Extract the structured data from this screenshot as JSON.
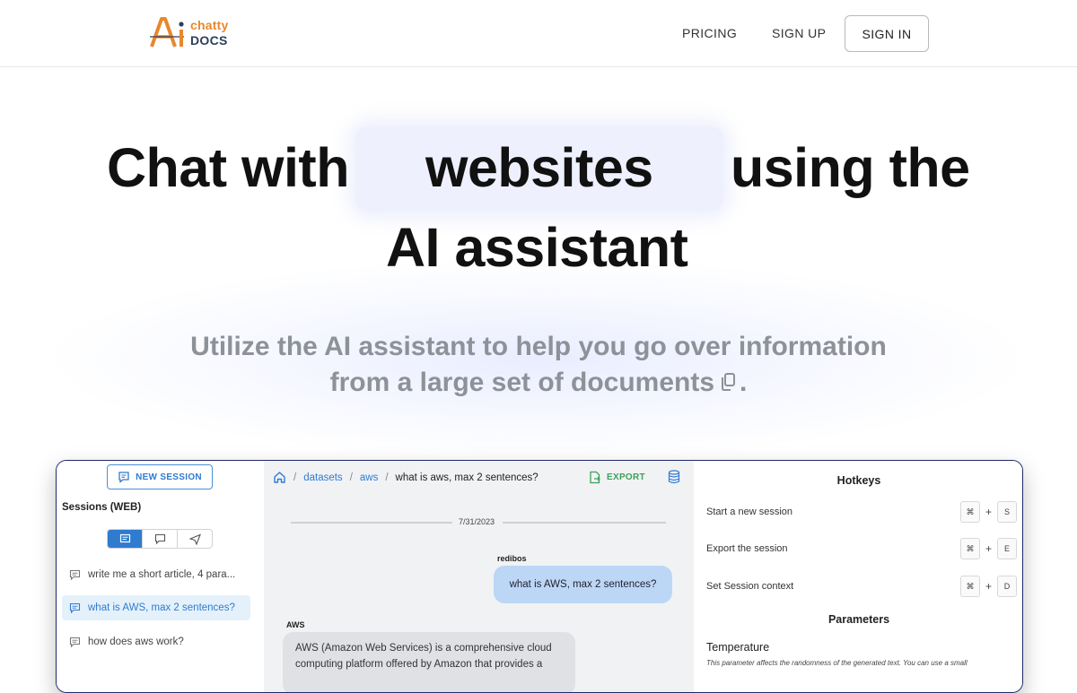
{
  "brand": {
    "name_top": "chatty",
    "name_bottom": "DOCS",
    "accent": "#e8872b",
    "dark": "#2c3f5c"
  },
  "nav": {
    "pricing": "PRICING",
    "signup": "SIGN UP",
    "signin": "SIGN IN"
  },
  "hero": {
    "line1_before": "Chat with",
    "highlight": "websites",
    "line1_after": "using the",
    "line2": "AI assistant",
    "sub_line1": "Utilize the AI assistant to help you go over information",
    "sub_line2": "from a large set of documents",
    "sub_end": ".",
    "sub_icon": "copy-icon"
  },
  "app": {
    "sidebar": {
      "new_session": "NEW SESSION",
      "sessions_title": "Sessions (WEB)",
      "tabs": [
        "list-icon",
        "chat-icon",
        "send-icon"
      ],
      "sessions": [
        {
          "label": "write me a short article, 4 para...",
          "active": false
        },
        {
          "label": "what is AWS, max 2 sentences?",
          "active": true
        },
        {
          "label": "how does aws work?",
          "active": false
        }
      ]
    },
    "chat": {
      "crumbs": {
        "home_icon": "home-icon",
        "datasets": "datasets",
        "aws": "aws",
        "current": "what is aws, max 2 sentences?"
      },
      "export": "EXPORT",
      "date": "7/31/2023",
      "user_name": "redibos",
      "user_msg": "what is AWS, max 2 sentences?",
      "bot_name": "AWS",
      "bot_msg": "AWS (Amazon Web Services) is a comprehensive cloud computing platform offered by Amazon that provides a"
    },
    "right": {
      "hotkeys_title": "Hotkeys",
      "hotkeys": [
        {
          "label": "Start a new session",
          "mod": "⌘",
          "key": "S"
        },
        {
          "label": "Export the session",
          "mod": "⌘",
          "key": "E"
        },
        {
          "label": "Set Session context",
          "mod": "⌘",
          "key": "D"
        }
      ],
      "plus": "+",
      "params_title": "Parameters",
      "temperature_label": "Temperature",
      "temperature_desc": "This parameter affects the randomness of the generated text. You can use a small"
    }
  }
}
